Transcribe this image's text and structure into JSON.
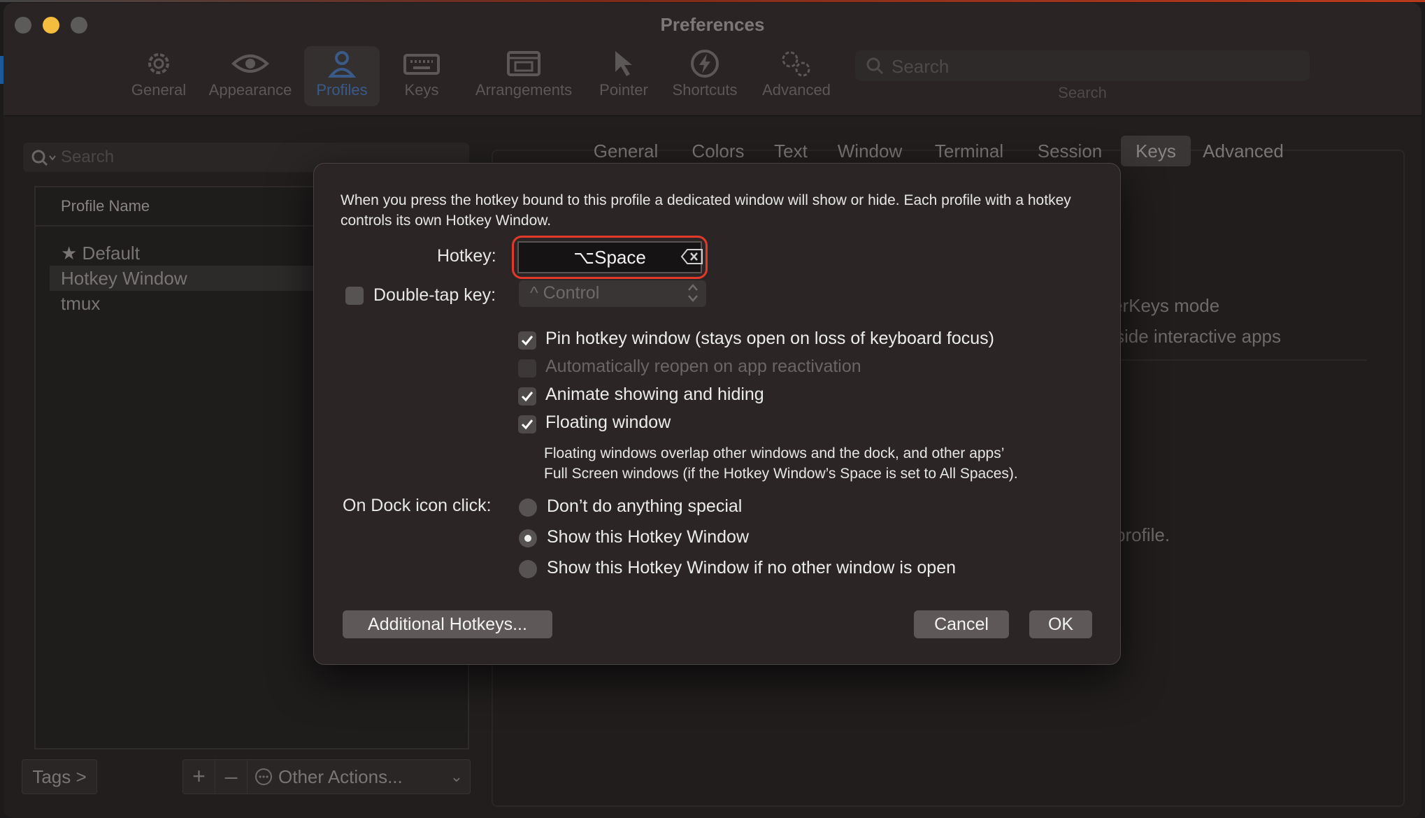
{
  "window": {
    "title": "Preferences"
  },
  "toolbar": {
    "items": [
      {
        "label": "General",
        "icon": "gear-icon"
      },
      {
        "label": "Appearance",
        "icon": "eye-icon"
      },
      {
        "label": "Profiles",
        "icon": "person-icon",
        "active": true
      },
      {
        "label": "Keys",
        "icon": "keyboard-icon"
      },
      {
        "label": "Arrangements",
        "icon": "windows-icon"
      },
      {
        "label": "Pointer",
        "icon": "pointer-icon"
      },
      {
        "label": "Shortcuts",
        "icon": "lightning-icon"
      },
      {
        "label": "Advanced",
        "icon": "gears-icon"
      }
    ],
    "search_placeholder": "Search",
    "search_label": "Search"
  },
  "sidebar": {
    "search_placeholder": "Search",
    "header": "Profile Name",
    "profiles": [
      {
        "name": "Default",
        "star": "★"
      },
      {
        "name": "Hotkey Window",
        "selected": true
      },
      {
        "name": "tmux"
      }
    ],
    "tags_label": "Tags >",
    "add_label": "+",
    "remove_label": "–",
    "other_actions_label": "Other Actions...",
    "chevron": "⌄"
  },
  "profile_tabs": [
    "General",
    "Colors",
    "Text",
    "Window",
    "Terminal",
    "Session",
    "Keys",
    "Advanced"
  ],
  "active_profile_tab": "Keys",
  "background_fragments": {
    "line1": "erKeys mode",
    "line2": "side interactive apps",
    "line3": "profile."
  },
  "dialog": {
    "description": "When you press the hotkey bound to this profile a dedicated window will show or hide. Each profile with a hotkey controls its own Hotkey Window.",
    "hotkey_label": "Hotkey:",
    "hotkey_value": "⌥Space",
    "double_tap_label": "Double-tap key:",
    "double_tap_checked": false,
    "double_tap_select": "^ Control",
    "options": [
      {
        "label": "Pin hotkey window (stays open on loss of keyboard focus)",
        "checked": true,
        "disabled": false
      },
      {
        "label": "Automatically reopen on app reactivation",
        "checked": false,
        "disabled": true
      },
      {
        "label": "Animate showing and hiding",
        "checked": true,
        "disabled": false
      },
      {
        "label": "Floating window",
        "checked": true,
        "disabled": false
      }
    ],
    "floating_note_line1": "Floating windows overlap other windows and the dock, and other apps’",
    "floating_note_line2": "Full Screen windows (if the Hotkey Window’s Space is set to All Spaces).",
    "dock_label": "On Dock icon click:",
    "dock_options": [
      {
        "label": "Don’t do anything special",
        "selected": false
      },
      {
        "label": "Show this Hotkey Window",
        "selected": true
      },
      {
        "label": "Show this Hotkey Window if no other window is open",
        "selected": false
      }
    ],
    "additional_hotkeys_label": "Additional Hotkeys...",
    "cancel_label": "Cancel",
    "ok_label": "OK"
  }
}
